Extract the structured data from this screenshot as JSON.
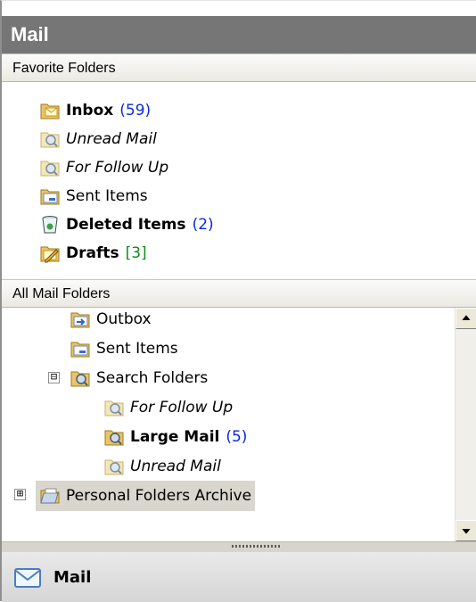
{
  "header": {
    "title": "Mail"
  },
  "favorites": {
    "title": "Favorite Folders",
    "items": [
      {
        "label": "Inbox",
        "count": "(59)",
        "style": "bold",
        "icon": "inbox-folder-icon"
      },
      {
        "label": "Unread Mail",
        "count": "",
        "style": "italic",
        "icon": "search-folder-icon"
      },
      {
        "label": "For Follow Up",
        "count": "",
        "style": "italic",
        "icon": "search-folder-icon"
      },
      {
        "label": "Sent Items",
        "count": "",
        "style": "normal",
        "icon": "sent-items-icon"
      },
      {
        "label": "Deleted Items",
        "count": "(2)",
        "style": "bold",
        "icon": "deleted-items-icon"
      },
      {
        "label": "Drafts",
        "count": "[3]",
        "style": "bold",
        "icon": "drafts-icon"
      }
    ]
  },
  "all_folders": {
    "title": "All Mail Folders",
    "items": [
      {
        "label": "Outbox",
        "count": "",
        "style": "normal",
        "icon": "outbox-icon"
      },
      {
        "label": "Sent Items",
        "count": "",
        "style": "normal",
        "icon": "sent-items-icon"
      },
      {
        "label": "Search Folders",
        "count": "",
        "style": "normal",
        "icon": "search-folders-icon",
        "expander": "⊟"
      },
      {
        "label": "For Follow Up",
        "count": "",
        "style": "italic",
        "icon": "search-folder-icon"
      },
      {
        "label": "Large Mail",
        "count": "(5)",
        "style": "bold",
        "icon": "search-folder-icon"
      },
      {
        "label": "Unread Mail",
        "count": "",
        "style": "italic",
        "icon": "search-folder-icon"
      },
      {
        "label": "Personal Folders Archive",
        "count": "",
        "style": "normal",
        "icon": "personal-folders-icon",
        "expander": "⊞"
      }
    ]
  },
  "nav": {
    "mail_label": "Mail"
  }
}
